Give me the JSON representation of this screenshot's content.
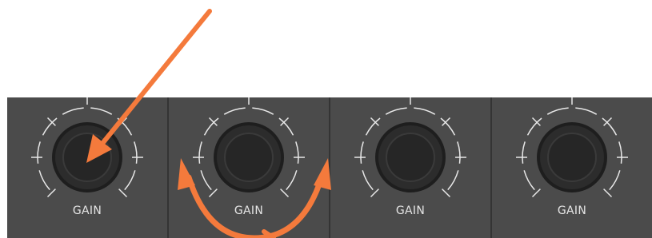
{
  "channels": [
    {
      "gain_label": "GAIN"
    },
    {
      "gain_label": "GAIN"
    },
    {
      "gain_label": "GAIN"
    },
    {
      "gain_label": "GAIN"
    }
  ],
  "colors": {
    "panel": "#4b4b4b",
    "divider": "#343434",
    "tick": "#e8e8e8",
    "knob": "#262626",
    "annotation": "#f47a3c"
  },
  "annotations": [
    "arrow-icon",
    "rotate-arrows-icon"
  ]
}
